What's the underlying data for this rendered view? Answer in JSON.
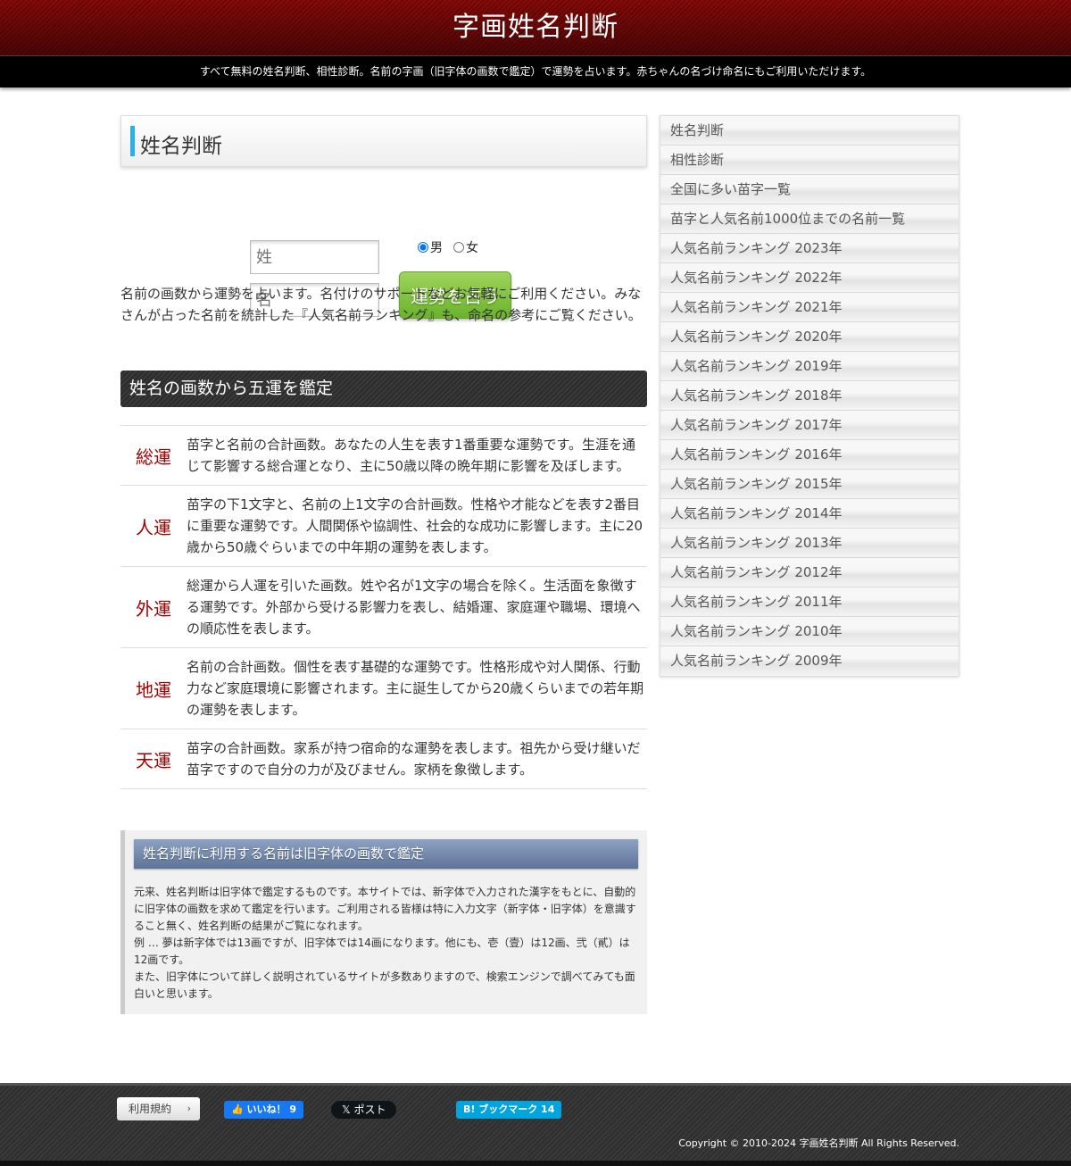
{
  "header": {
    "site_title": "字画姓名判断",
    "tagline": "すべて無料の姓名判断、相性診断。名前の字画（旧字体の画数で鑑定）で運勢を占います。赤ちゃんの名づけ命名にもご利用いただけます。"
  },
  "main": {
    "page_title": "姓名判断",
    "form": {
      "sei_placeholder": "姓",
      "mei_placeholder": "名",
      "gender_male": "男",
      "gender_female": "女",
      "selected_gender": "男",
      "submit_label": "運勢を占う"
    },
    "intro": "名前の画数から運勢を占います。名付けのサポートなどお気軽にご利用ください。みなさんが占った名前を統計した『人気名前ランキング』も、命名の参考にご覧ください。",
    "goun_heading": "姓名の画数から五運を鑑定",
    "goun": [
      {
        "name": "総運",
        "desc": "苗字と名前の合計画数。あなたの人生を表す1番重要な運勢です。生涯を通じて影響する総合運となり、主に50歳以降の晩年期に影響を及ぼします。"
      },
      {
        "name": "人運",
        "desc": "苗字の下1文字と、名前の上1文字の合計画数。性格や才能などを表す2番目に重要な運勢です。人間関係や協調性、社会的な成功に影響します。主に20歳から50歳ぐらいまでの中年期の運勢を表します。"
      },
      {
        "name": "外運",
        "desc": "総運から人運を引いた画数。姓や名が1文字の場合を除く。生活面を象徴する運勢です。外部から受ける影響力を表し、結婚運、家庭運や職場、環境への順応性を表します。"
      },
      {
        "name": "地運",
        "desc": "名前の合計画数。個性を表す基礎的な運勢です。性格形成や対人関係、行動力など家庭環境に影響されます。主に誕生してから20歳くらいまでの若年期の運勢を表します。"
      },
      {
        "name": "天運",
        "desc": "苗字の合計画数。家系が持つ宿命的な運勢を表します。祖先から受け継いだ苗字ですので自分の力が及びません。家柄を象徴します。"
      }
    ],
    "kyuji": {
      "heading": "姓名判断に利用する名前は旧字体の画数で鑑定",
      "lines": [
        "元来、姓名判断は旧字体で鑑定するものです。本サイトでは、新字体で入力された漢字をもとに、自動的に旧字体の画数を求めて鑑定を行います。ご利用される皆様は特に入力文字（新字体・旧字体）を意識すること無く、姓名判断の結果がご覧になれます。",
        "例 … 夢は新字体では13画ですが、旧字体では14画になります。他にも、壱（壹）は12画、弐（貳）は12画です。",
        "また、旧字体について詳しく説明されているサイトが多数ありますので、検索エンジンで調べてみても面白いと思います。"
      ]
    }
  },
  "sidebar": {
    "items": [
      "姓名判断",
      "相性診断",
      "全国に多い苗字一覧",
      "苗字と人気名前1000位までの名前一覧",
      "人気名前ランキング 2023年",
      "人気名前ランキング 2022年",
      "人気名前ランキング 2021年",
      "人気名前ランキング 2020年",
      "人気名前ランキング 2019年",
      "人気名前ランキング 2018年",
      "人気名前ランキング 2017年",
      "人気名前ランキング 2016年",
      "人気名前ランキング 2015年",
      "人気名前ランキング 2014年",
      "人気名前ランキング 2013年",
      "人気名前ランキング 2012年",
      "人気名前ランキング 2011年",
      "人気名前ランキング 2010年",
      "人気名前ランキング 2009年"
    ]
  },
  "footer": {
    "terms_label": "利用規約",
    "terms_chevron": "›",
    "fb_like": "👍 いいね！ 9",
    "x_post": "𝕏 ポスト",
    "hatena": "B! ブックマーク 14",
    "copyright": "Copyright © 2010-2024 字画姓名判断 All Rights Reserved."
  }
}
